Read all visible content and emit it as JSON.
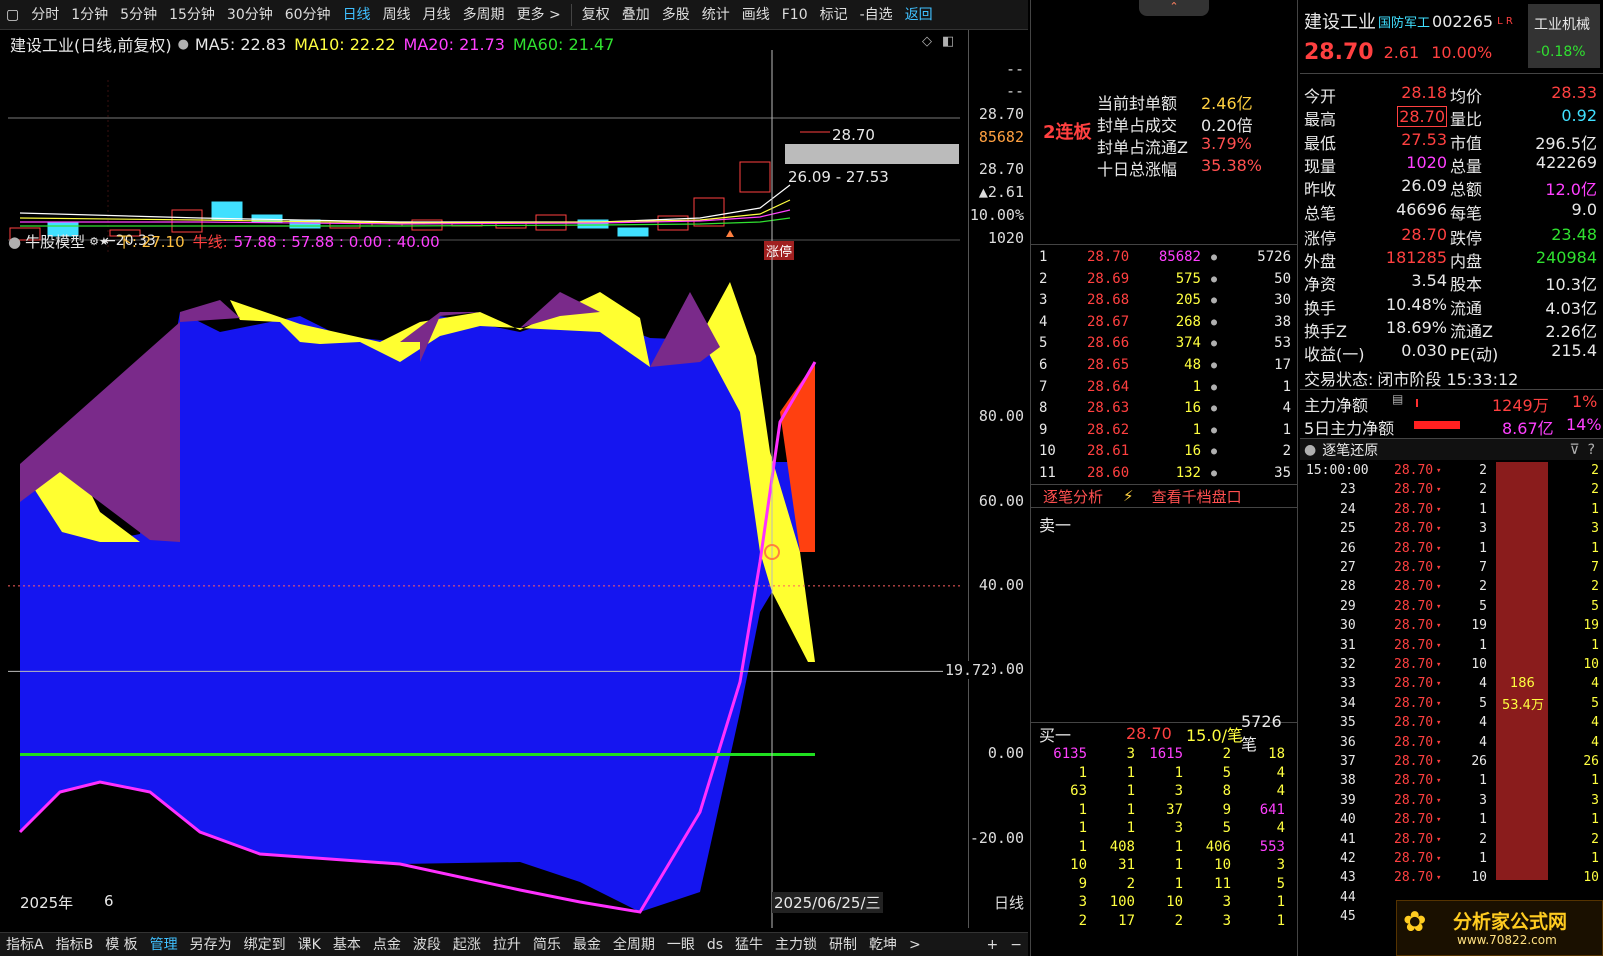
{
  "toolbar": {
    "periods": [
      "分时",
      "1分钟",
      "5分钟",
      "15分钟",
      "30分钟",
      "60分钟",
      "日线",
      "周线",
      "月线",
      "多周期",
      "更多 >"
    ],
    "active_period": "日线",
    "tools": [
      "复权",
      "叠加",
      "多股",
      "统计",
      "画线",
      "F10",
      "标记",
      "-自选",
      "返回"
    ]
  },
  "chart_header": {
    "title": "建设工业(日线,前复权)",
    "ma5": "MA5: 22.83",
    "ma10": "MA10: 22.22",
    "ma20": "MA20: 21.73",
    "ma60": "MA60: 21.47"
  },
  "price_panel": {
    "labels": {
      "high_price": "28.70",
      "range": "26.09 - 27.53",
      "low_marker": "←20.33",
      "zt": "涨停"
    },
    "axis": [
      "--",
      "--",
      "28.70",
      "85682",
      "28.70",
      "▲2.61",
      "10.00%"
    ]
  },
  "indicator": {
    "name": "牛股模型",
    "legend_a": "下: 27.10",
    "legend_b_label": "牛线:",
    "legend_b_values": "57.88 : 57.88 : 0.00 : 40.00",
    "axis_labels": [
      "1020",
      "80.00",
      "60.00",
      "40.00",
      "20.00",
      "0.00",
      "-20.00"
    ],
    "crosshair_value": "19.72",
    "dashed_level": 40,
    "zero_level": 0,
    "ylim": [
      -35,
      95
    ]
  },
  "time_axis": {
    "year": "2025年",
    "month": "6",
    "cursor_date": "2025/06/25/三",
    "period_label": "日线"
  },
  "bottom_tabs": [
    "指标A",
    "指标B",
    "模 板",
    "管理",
    "另存为",
    "绑定到",
    "课K",
    "基本",
    "点金",
    "波段",
    "起涨",
    "拉升",
    "简乐",
    "最金",
    "全周期",
    "一眼",
    "ds",
    "猛牛",
    "主力锁",
    "研制",
    "乾坤",
    ">"
  ],
  "bottom_active": "管理",
  "bottom_right": [
    "+",
    "−"
  ],
  "seal": {
    "streak": "2连板",
    "rows": [
      {
        "label": "当前封单额",
        "value": "2.46亿"
      },
      {
        "label": "封单占成交",
        "value": "0.20倍"
      },
      {
        "label": "封单占流通Z",
        "value": "3.79%"
      },
      {
        "label": "十日总涨幅",
        "value": "35.38%"
      }
    ]
  },
  "order_book": {
    "rows": [
      {
        "lvl": "1",
        "price": "28.70",
        "vol": "85682",
        "cnt": "5726"
      },
      {
        "lvl": "2",
        "price": "28.69",
        "vol": "575",
        "cnt": "50"
      },
      {
        "lvl": "3",
        "price": "28.68",
        "vol": "205",
        "cnt": "30"
      },
      {
        "lvl": "4",
        "price": "28.67",
        "vol": "268",
        "cnt": "38"
      },
      {
        "lvl": "5",
        "price": "28.66",
        "vol": "374",
        "cnt": "53"
      },
      {
        "lvl": "6",
        "price": "28.65",
        "vol": "48",
        "cnt": "17"
      },
      {
        "lvl": "7",
        "price": "28.64",
        "vol": "1",
        "cnt": "1"
      },
      {
        "lvl": "8",
        "price": "28.63",
        "vol": "16",
        "cnt": "4"
      },
      {
        "lvl": "9",
        "price": "28.62",
        "vol": "1",
        "cnt": "1"
      },
      {
        "lvl": "10",
        "price": "28.61",
        "vol": "16",
        "cnt": "2"
      },
      {
        "lvl": "11",
        "price": "28.60",
        "vol": "132",
        "cnt": "35"
      }
    ],
    "tab_left": "逐笔分析",
    "tab_right": "查看千档盘口",
    "sell_one": "卖一",
    "buy_one": {
      "label": "买一",
      "price": "28.70",
      "per": "15.0/笔",
      "count": "5726笔"
    },
    "queue": [
      [
        "6135",
        "3",
        "1615",
        "2",
        "18"
      ],
      [
        "1",
        "1",
        "1",
        "5",
        "4"
      ],
      [
        "63",
        "1",
        "3",
        "8",
        "4"
      ],
      [
        "1",
        "1",
        "37",
        "9",
        "641"
      ],
      [
        "1",
        "1",
        "3",
        "5",
        "4"
      ],
      [
        "1",
        "408",
        "1",
        "406",
        "553"
      ],
      [
        "10",
        "31",
        "1",
        "10",
        "3"
      ],
      [
        "9",
        "2",
        "1",
        "11",
        "5"
      ],
      [
        "3",
        "100",
        "10",
        "3",
        "1"
      ],
      [
        "2",
        "17",
        "2",
        "3",
        "1"
      ]
    ]
  },
  "quote": {
    "name": "建设工业",
    "tag": "国防军工",
    "code": "002265",
    "flag": "L R",
    "industry": "工业机械",
    "industry_change": "-0.18%",
    "price": "28.70",
    "change": "2.61",
    "pct": "10.00%",
    "rows": [
      {
        "l1": "今开",
        "v1": "28.18",
        "c1": "r",
        "l2": "均价",
        "v2": "28.33",
        "c2": "r"
      },
      {
        "l1": "最高",
        "v1": "28.70",
        "c1": "r",
        "l2": "量比",
        "v2": "0.92",
        "c2": "c"
      },
      {
        "l1": "最低",
        "v1": "27.53",
        "c1": "r",
        "l2": "市值",
        "v2": "296.5亿",
        "c2": "w"
      },
      {
        "l1": "现量",
        "v1": "1020",
        "c1": "m",
        "l2": "总量",
        "v2": "422269",
        "c2": "w"
      },
      {
        "l1": "昨收",
        "v1": "26.09",
        "c1": "w",
        "l2": "总额",
        "v2": "12.0亿",
        "c2": "m"
      },
      {
        "l1": "总笔",
        "v1": "46696",
        "c1": "w",
        "l2": "每笔",
        "v2": "9.0",
        "c2": "w"
      },
      {
        "l1": "涨停",
        "v1": "28.70",
        "c1": "r",
        "l2": "跌停",
        "v2": "23.48",
        "c2": "g"
      },
      {
        "l1": "外盘",
        "v1": "181285",
        "c1": "r",
        "l2": "内盘",
        "v2": "240984",
        "c2": "g"
      },
      {
        "l1": "净资",
        "v1": "3.54",
        "c1": "w",
        "l2": "股本",
        "v2": "10.3亿",
        "c2": "w"
      },
      {
        "l1": "换手",
        "v1": "10.48%",
        "c1": "w",
        "l2": "流通",
        "v2": "4.03亿",
        "c2": "w"
      },
      {
        "l1": "换手Z",
        "v1": "18.69%",
        "c1": "w",
        "l2": "流通Z",
        "v2": "2.26亿",
        "c2": "w"
      },
      {
        "l1": "收益(一)",
        "v1": "0.030",
        "c1": "w",
        "l2": "PE(动)",
        "v2": "215.4",
        "c2": "w"
      }
    ],
    "status_label": "交易状态:",
    "status_value": "闭市阶段 15:33:12",
    "main_net": {
      "label": "主力净额",
      "value": "1249万",
      "pct": "1%"
    },
    "main_net5": {
      "label": "5日主力净额",
      "value": "8.67亿",
      "pct": "14%"
    }
  },
  "ticks": {
    "title": "逐笔还原",
    "rows": [
      {
        "t": "15:00:00",
        "p": "28.70",
        "v": "2",
        "n": "2"
      },
      {
        "t": "23",
        "p": "28.70",
        "v": "2",
        "n": "2"
      },
      {
        "t": "24",
        "p": "28.70",
        "v": "1",
        "n": "1"
      },
      {
        "t": "25",
        "p": "28.70",
        "v": "3",
        "n": "3"
      },
      {
        "t": "26",
        "p": "28.70",
        "v": "1",
        "n": "1"
      },
      {
        "t": "27",
        "p": "28.70",
        "v": "7",
        "n": "7"
      },
      {
        "t": "28",
        "p": "28.70",
        "v": "2",
        "n": "2"
      },
      {
        "t": "29",
        "p": "28.70",
        "v": "5",
        "n": "5"
      },
      {
        "t": "30",
        "p": "28.70",
        "v": "19",
        "n": "19"
      },
      {
        "t": "31",
        "p": "28.70",
        "v": "1",
        "n": "1"
      },
      {
        "t": "32",
        "p": "28.70",
        "v": "10",
        "n": "10"
      },
      {
        "t": "33",
        "p": "28.70",
        "v": "4",
        "n": "4"
      },
      {
        "t": "34",
        "p": "28.70",
        "v": "5",
        "n": "5"
      },
      {
        "t": "35",
        "p": "28.70",
        "v": "4",
        "n": "4"
      },
      {
        "t": "36",
        "p": "28.70",
        "v": "4",
        "n": "4"
      },
      {
        "t": "37",
        "p": "28.70",
        "v": "26",
        "n": "26"
      },
      {
        "t": "38",
        "p": "28.70",
        "v": "1",
        "n": "1"
      },
      {
        "t": "39",
        "p": "28.70",
        "v": "3",
        "n": "3"
      },
      {
        "t": "40",
        "p": "28.70",
        "v": "1",
        "n": "1"
      },
      {
        "t": "41",
        "p": "28.70",
        "v": "2",
        "n": "2"
      },
      {
        "t": "42",
        "p": "28.70",
        "v": "1",
        "n": "1"
      },
      {
        "t": "43",
        "p": "28.70",
        "v": "10",
        "n": "10"
      },
      {
        "t": "44",
        "p": "",
        "v": "",
        "n": ""
      },
      {
        "t": "45",
        "p": "",
        "v": "",
        "n": ""
      }
    ],
    "bar_label_a": "186",
    "bar_label_b": "53.4万"
  },
  "watermark": {
    "name": "分析家公式网",
    "url": "www.70822.com"
  },
  "colors": {
    "up": "#ff4040",
    "down": "#30e030",
    "blue_fill": "#1515f0",
    "yellow": "#ffff30",
    "purple": "#7a2a8a",
    "magenta_line": "#ff30ff",
    "green_line": "#20e020"
  }
}
